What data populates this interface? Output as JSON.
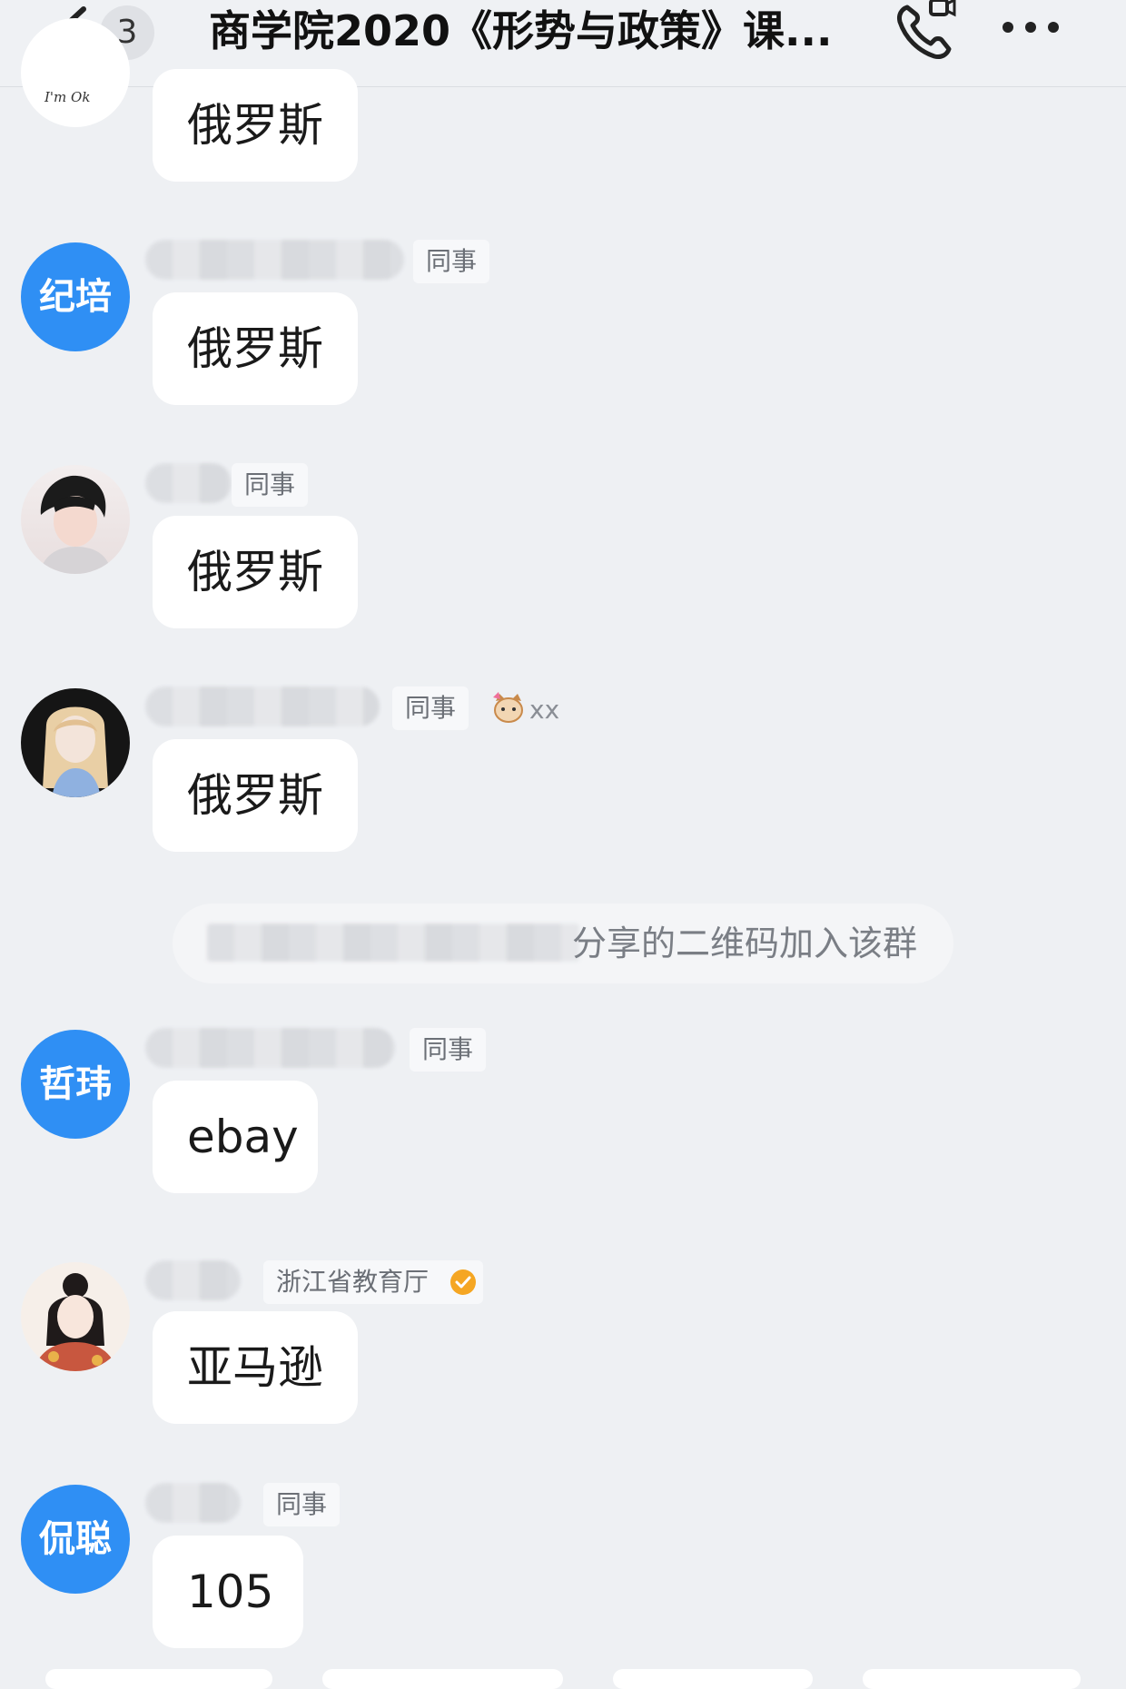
{
  "header": {
    "unread_count": "3",
    "title": "商学院2020《形势与政策》课..."
  },
  "messages": [
    {
      "avatar_type": "image",
      "avatar_caption": "I'm Ok",
      "tag": "",
      "text": "俄罗斯"
    },
    {
      "avatar_type": "text",
      "avatar_text": "纪培",
      "tag": "同事",
      "text": "俄罗斯"
    },
    {
      "avatar_type": "image",
      "tag": "同事",
      "text": "俄罗斯"
    },
    {
      "avatar_type": "image",
      "tag": "同事",
      "extra": "xx",
      "text": "俄罗斯"
    },
    {
      "avatar_type": "text",
      "avatar_text": "哲玮",
      "tag": "同事",
      "text": "ebay"
    },
    {
      "avatar_type": "image",
      "tag": "浙江省教育厅",
      "verified": true,
      "text": "亚马逊"
    },
    {
      "avatar_type": "text",
      "avatar_text": "侃聪",
      "tag": "同事",
      "text": "105"
    }
  ],
  "system_notice": {
    "text": "分享的二维码加入该群"
  },
  "colors": {
    "accent": "#2f8ff4",
    "background": "#eef0f3",
    "bubble": "#ffffff",
    "verified": "#f5a623"
  }
}
